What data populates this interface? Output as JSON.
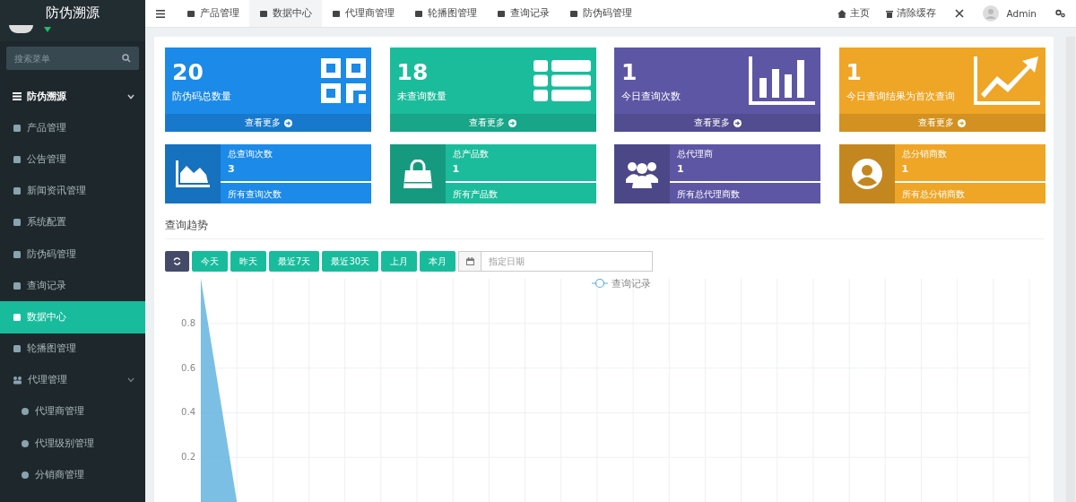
{
  "sidebar": {
    "title": "防伪溯源",
    "search": {
      "placeholder": "搜索菜单"
    },
    "menu": [
      {
        "label": "防伪溯源",
        "kind": "header",
        "expanded": true
      },
      {
        "label": "产品管理",
        "kind": "item",
        "selected": false
      },
      {
        "label": "公告管理",
        "kind": "item",
        "selected": false
      },
      {
        "label": "新闻资讯管理",
        "kind": "item",
        "selected": false
      },
      {
        "label": "系统配置",
        "kind": "item",
        "selected": false
      },
      {
        "label": "防伪码管理",
        "kind": "item",
        "selected": false
      },
      {
        "label": "查询记录",
        "kind": "item",
        "selected": false
      },
      {
        "label": "数据中心",
        "kind": "item",
        "selected": true
      },
      {
        "label": "轮播图管理",
        "kind": "item",
        "selected": false
      },
      {
        "label": "代理管理",
        "kind": "group",
        "expanded": true,
        "children": [
          {
            "label": "代理商管理",
            "selected": false
          },
          {
            "label": "代理级别管理",
            "selected": false
          },
          {
            "label": "分销商管理",
            "selected": false
          }
        ]
      }
    ]
  },
  "tabs": [
    {
      "label": "产品管理",
      "selected": false
    },
    {
      "label": "数据中心",
      "selected": true
    },
    {
      "label": "代理商管理",
      "selected": false
    },
    {
      "label": "轮播图管理",
      "selected": false
    },
    {
      "label": "查询记录",
      "selected": false
    },
    {
      "label": "防伪码管理",
      "selected": false
    }
  ],
  "top_right": {
    "home": "主页",
    "clear_cache": "清除缓存",
    "user": "Admin"
  },
  "stat_cards": [
    {
      "value": "20",
      "label": "防伪码总数量",
      "footer": "查看更多",
      "color": "#1b8ae8"
    },
    {
      "value": "18",
      "label": "未查询数量",
      "footer": "查看更多",
      "color": "#1bbc9b"
    },
    {
      "value": "1",
      "label": "今日查询次数",
      "footer": "查看更多",
      "color": "#5d56a4"
    },
    {
      "value": "1",
      "label": "今日查询结果为首次查询",
      "footer": "查看更多",
      "color": "#efa526"
    }
  ],
  "info_cards": [
    {
      "title": "总查询次数",
      "value": "3",
      "footer": "所有查询次数",
      "color": "#1b8ae8"
    },
    {
      "title": "总产品数",
      "value": "1",
      "footer": "所有产品数",
      "color": "#1bbc9b"
    },
    {
      "title": "总代理商",
      "value": "1",
      "footer": "所有总代理商数",
      "color": "#5d56a4"
    },
    {
      "title": "总分销商数",
      "value": "1",
      "footer": "所有总分销商数",
      "color": "#efa526"
    }
  ],
  "trend": {
    "title": "查询趋势",
    "buttons": [
      "今天",
      "昨天",
      "最近7天",
      "最近30天",
      "上月",
      "本月"
    ],
    "date": {
      "placeholder": "指定日期"
    },
    "chart_data": {
      "type": "area",
      "grid": true,
      "ylim": [
        0,
        1
      ],
      "yticks": [
        0.2,
        0.4,
        0.6,
        0.8
      ],
      "series": [
        {
          "name": "查询记录",
          "color": "#5aafde",
          "values": [
            1,
            0,
            0,
            0,
            0,
            0,
            0,
            0,
            0,
            0,
            0,
            0,
            0,
            0,
            0,
            0,
            0,
            0,
            0,
            0,
            0,
            0,
            0,
            0
          ]
        }
      ]
    }
  }
}
